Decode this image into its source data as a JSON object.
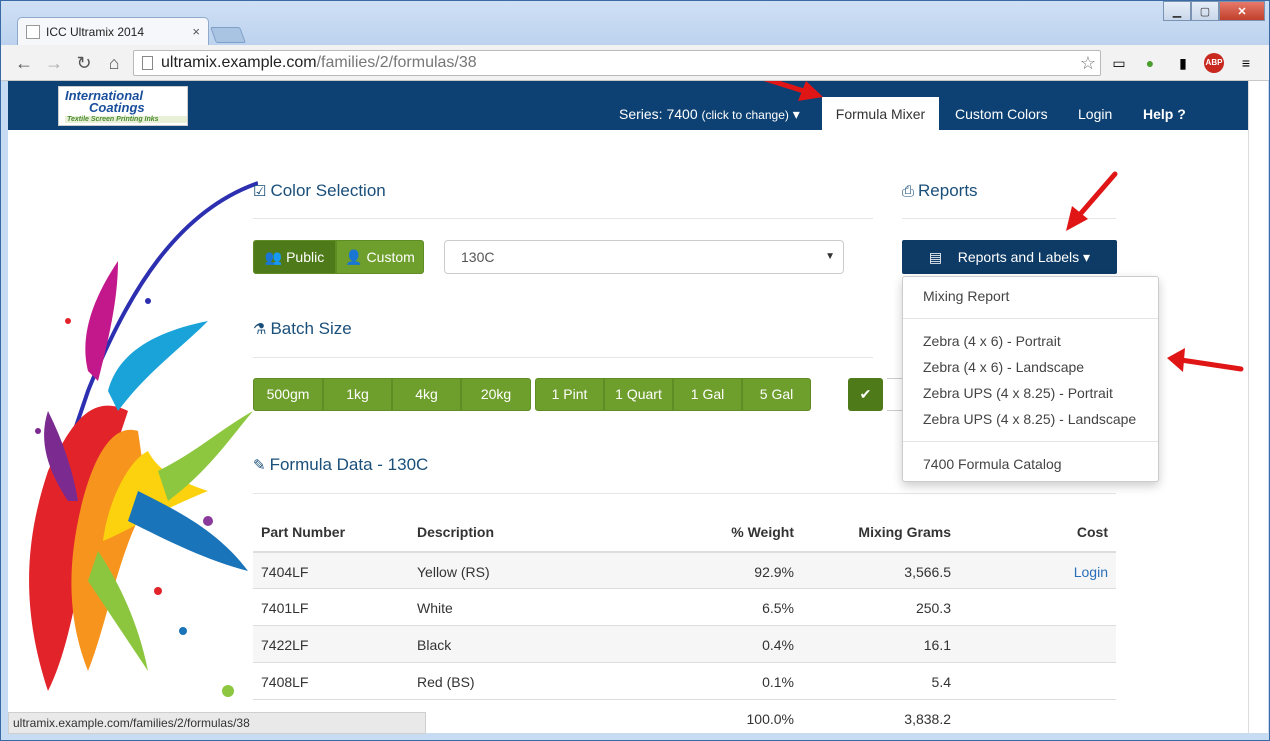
{
  "browser": {
    "tab_title": "ICC Ultramix 2014",
    "tab_close": "×",
    "url_host": "ultramix.example.com",
    "url_path": "/families/2/formulas/38",
    "status_url": "ultramix.example.com/families/2/formulas/38",
    "abp_label": "ABP"
  },
  "logo": {
    "line1": "International",
    "line2": "Coatings",
    "line3": "Textile Screen Printing Inks"
  },
  "nav": {
    "series_label": "Series: 7400",
    "series_hint": "(click to change)",
    "items": [
      "Formula Mixer",
      "Custom Colors",
      "Login",
      "Help ?"
    ]
  },
  "color_selection": {
    "title": "Color Selection",
    "public_label": "Public",
    "custom_label": "Custom",
    "selected_color": "130C"
  },
  "reports": {
    "title": "Reports",
    "button_label": "Reports and Labels",
    "menu": [
      "Mixing Report",
      "Zebra (4 x 6) - Portrait",
      "Zebra (4 x 6) - Landscape",
      "Zebra UPS (4 x 8.25) - Portrait",
      "Zebra UPS (4 x 8.25) - Landscape",
      "7400 Formula Catalog"
    ]
  },
  "batch": {
    "title": "Batch Size",
    "metric": [
      "500gm",
      "1kg",
      "4kg",
      "20kg"
    ],
    "imperial": [
      "1 Pint",
      "1 Quart",
      "1 Gal",
      "5 Gal"
    ]
  },
  "formula": {
    "title": "Formula Data - 130C",
    "headers": [
      "Part Number",
      "Description",
      "% Weight",
      "Mixing Grams",
      "Cost"
    ],
    "rows": [
      {
        "part": "7404LF",
        "desc": "Yellow (RS)",
        "weight": "92.9%",
        "grams": "3,566.5",
        "cost": "Login"
      },
      {
        "part": "7401LF",
        "desc": "White",
        "weight": "6.5%",
        "grams": "250.3",
        "cost": ""
      },
      {
        "part": "7422LF",
        "desc": "Black",
        "weight": "0.4%",
        "grams": "16.1",
        "cost": ""
      },
      {
        "part": "7408LF",
        "desc": "Red (BS)",
        "weight": "0.1%",
        "grams": "5.4",
        "cost": ""
      }
    ],
    "total": {
      "weight": "100.0%",
      "grams": "3,838.2"
    }
  },
  "colors": {
    "navbar": "#0d4173",
    "green": "#6e9e2c",
    "navy_button": "#0d3b66",
    "arrow": "#e01515"
  }
}
